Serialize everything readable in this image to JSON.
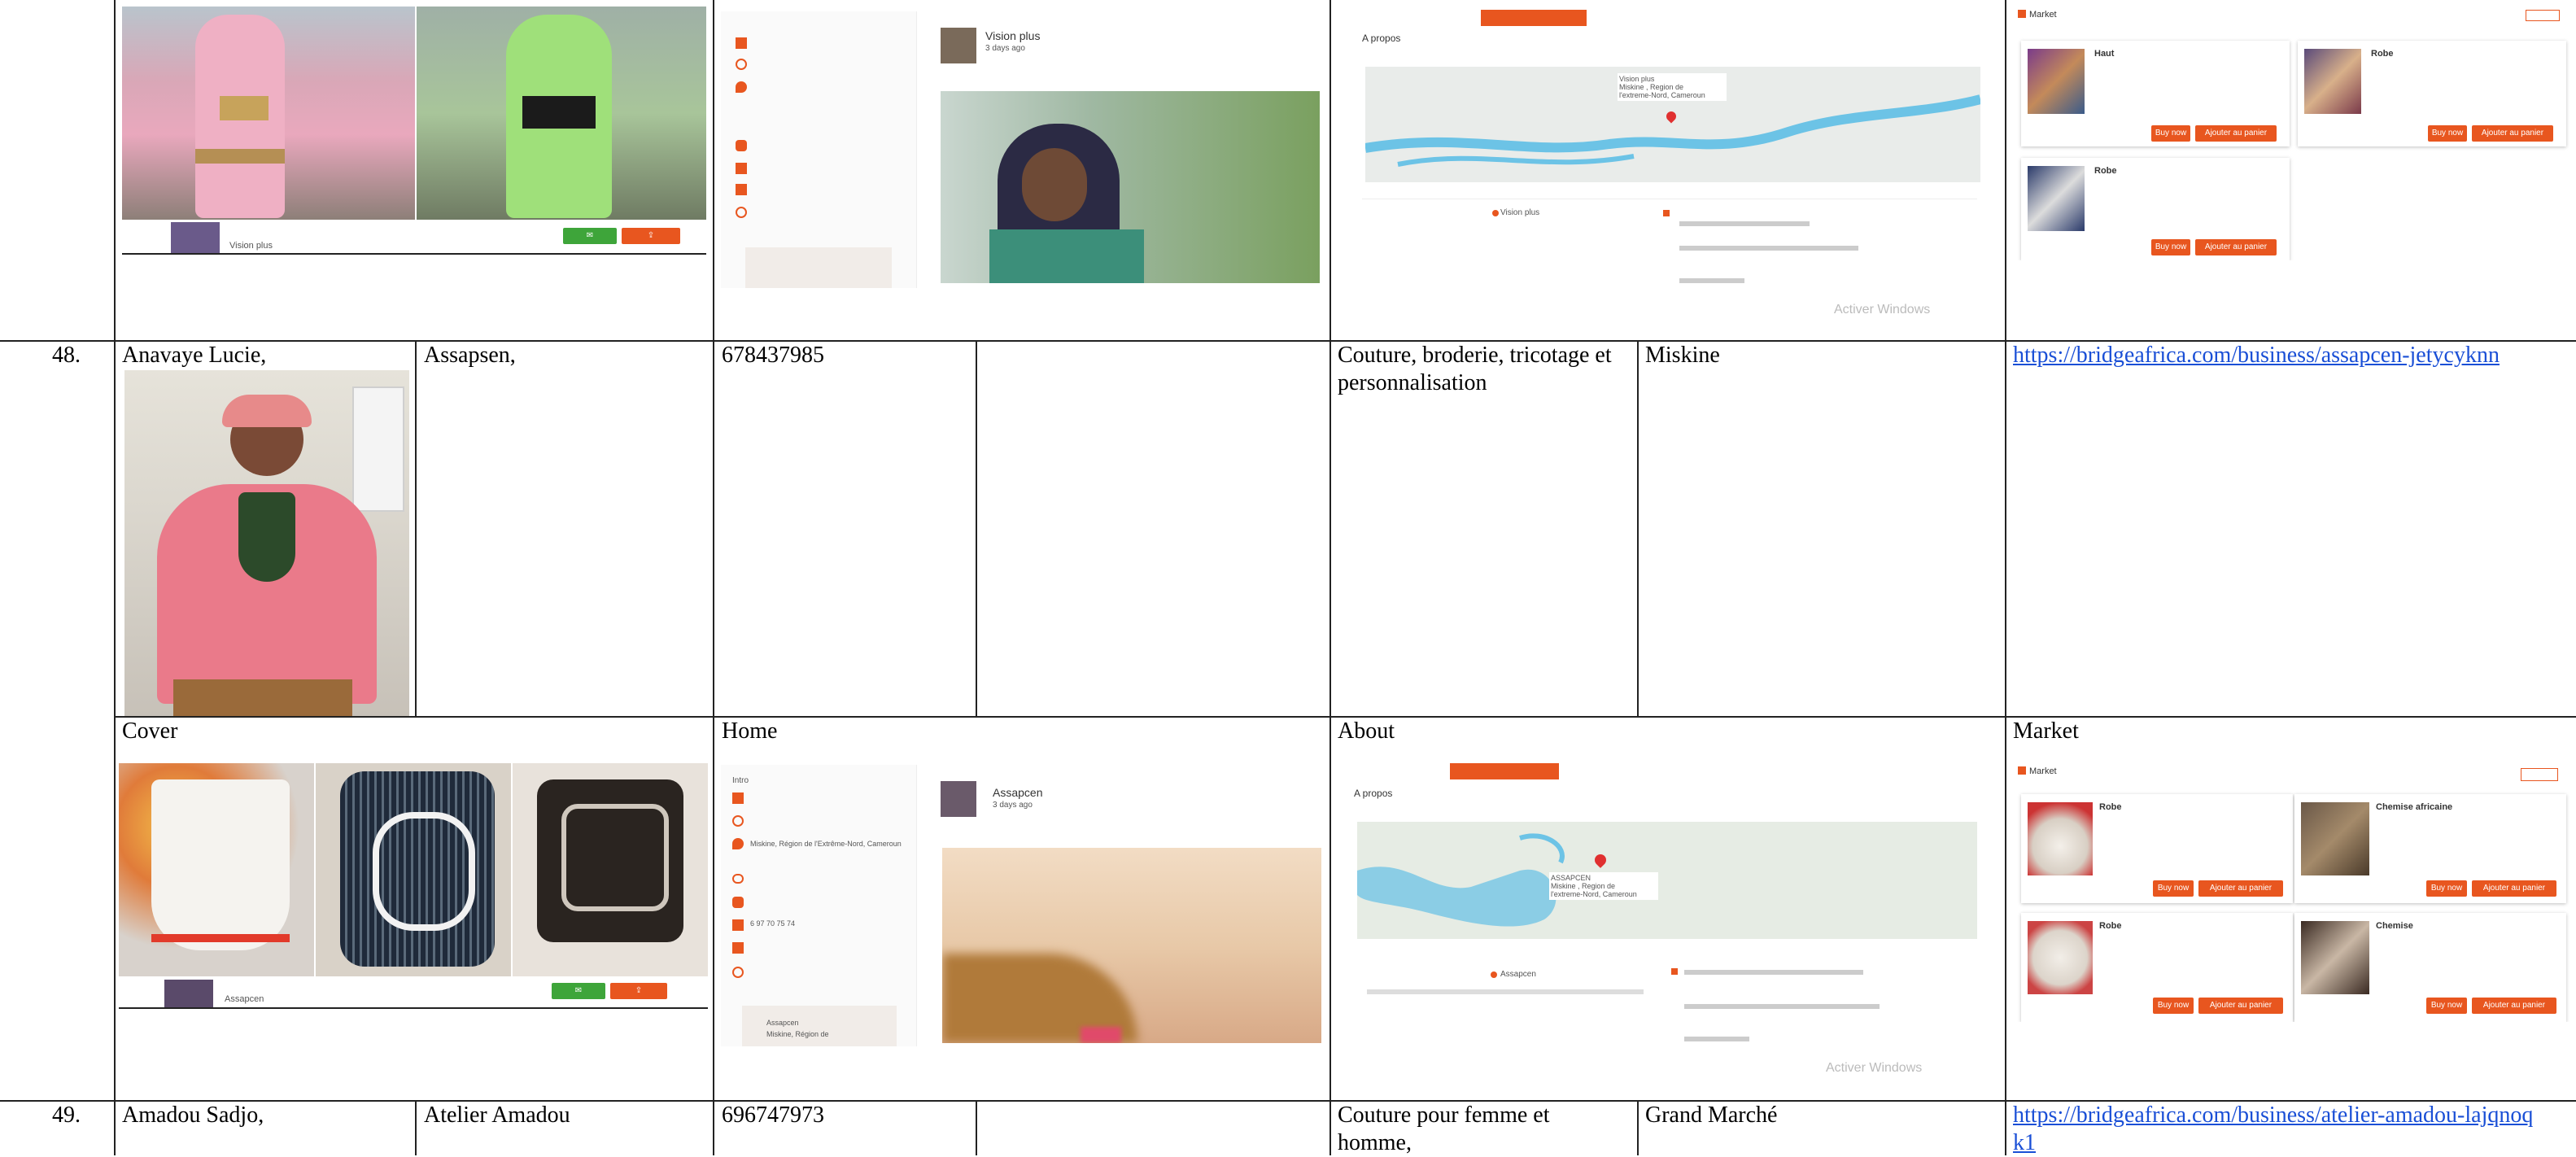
{
  "rows": [
    {
      "number": "48.",
      "name": "Anavaye Lucie,",
      "business": "Assapsen,",
      "phone": "678437985",
      "activity": "Couture, broderie, tricotage et personnalisation",
      "location": "Miskine",
      "url": "https://bridgeafrica.com/business/assapcen-jetycyknn"
    },
    {
      "number": "49.",
      "name": "Amadou Sadjo,",
      "business": "Atelier Amadou",
      "phone": "696747973",
      "activity": "Couture pour femme et homme,",
      "location": "Grand Marché",
      "url": "https://bridgeafrica.com/business/atelier-amadou-lajqnoqk1"
    }
  ],
  "section_labels": {
    "cover": "Cover",
    "home": "Home",
    "about": "About",
    "market": "Market"
  },
  "top_screens": {
    "cover_name": "Vision plus",
    "home_name": "Vision plus",
    "home_sub": "3 days ago",
    "about_heading": "A propos",
    "about_name": "Vision plus",
    "map_label": "Vision plus\nMiskine , Region de\nl'extreme-Nord, Cameroun",
    "market_title": "Market",
    "market_items": [
      "Haut",
      "Robe",
      "Robe"
    ],
    "buy_label": "Buy now",
    "cart_label": "Ajouter au panier",
    "watermark": "Activer Windows"
  },
  "bottom_screens": {
    "cover_name": "Assapcen",
    "home_name": "Assapcen",
    "home_sub": "3 days ago",
    "home_intro": "Intro",
    "home_address": "Miskine, Région de l'Extrême-Nord, Cameroun",
    "home_phone": "6 97 70 75 74",
    "home_post_name": "Assapcen",
    "home_post_addr": "Miskine, Région de",
    "about_heading": "A propos",
    "about_name": "Assapcen",
    "map_label": "ASSAPCEN\nMiskine , Region de\nl'extreme-Nord, Cameroun",
    "market_title": "Market",
    "market_items": [
      "Robe",
      "Chemise africaine",
      "Robe",
      "Chemise"
    ],
    "buy_label": "Buy now",
    "cart_label": "Ajouter au panier",
    "watermark": "Activer Windows"
  },
  "icons": [
    "envelope-icon",
    "search-icon",
    "pin-icon",
    "link-icon",
    "users-icon",
    "phone-icon",
    "clock-icon",
    "map-marker-icon"
  ],
  "colors": {
    "accent": "#e8561f",
    "link": "#1a4fd6",
    "map_water": "#6cc3e6",
    "yellow": "#f5d21c",
    "green": "#3ea53a"
  }
}
